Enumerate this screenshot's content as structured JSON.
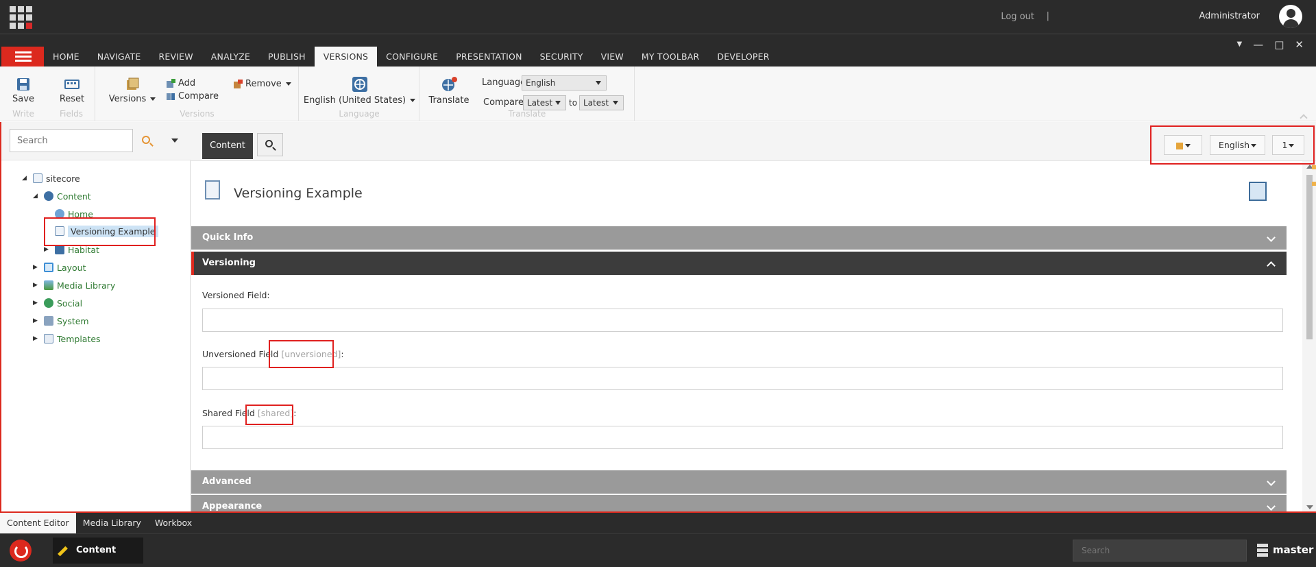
{
  "topbar": {
    "logout": "Log out",
    "separator": "|",
    "user": "Administrator"
  },
  "tabs": [
    "HOME",
    "NAVIGATE",
    "REVIEW",
    "ANALYZE",
    "PUBLISH",
    "VERSIONS",
    "CONFIGURE",
    "PRESENTATION",
    "SECURITY",
    "VIEW",
    "MY TOOLBAR",
    "DEVELOPER"
  ],
  "active_tab": "VERSIONS",
  "ribbon": {
    "write": {
      "save": "Save",
      "label": "Write"
    },
    "fields": {
      "reset": "Reset",
      "label": "Fields"
    },
    "versions": {
      "versions": "Versions",
      "add": "Add",
      "compare": "Compare",
      "remove": "Remove",
      "label": "Versions"
    },
    "language": {
      "current": "English (United States)",
      "label": "Language"
    },
    "translate": {
      "translate": "Translate",
      "language_label": "Language",
      "language_value": "English",
      "compare_label": "Compare",
      "compare_from": "Latest",
      "to_label": "to",
      "compare_to": "Latest",
      "label": "Translate"
    }
  },
  "left": {
    "search_placeholder": "Search",
    "tree": {
      "sitecore": "sitecore",
      "content": "Content",
      "home": "Home",
      "versioning_example": "Versioning Example",
      "habitat": "Habitat",
      "layout": "Layout",
      "media_library": "Media Library",
      "social": "Social",
      "system": "System",
      "templates": "Templates"
    }
  },
  "content": {
    "tab": "Content",
    "language": "English",
    "version": "1",
    "item_title": "Versioning Example",
    "sections": {
      "quick_info": "Quick Info",
      "versioning": "Versioning",
      "advanced": "Advanced",
      "appearance": "Appearance"
    },
    "fields": {
      "versioned_label": "Versioned Field:",
      "unversioned_label": "Unversioned Field",
      "unversioned_tag": "[unversioned]",
      "shared_label": "Shared Field",
      "shared_tag": "[shared]",
      "colon": ":"
    }
  },
  "bottom_tabs": [
    "Content Editor",
    "Media Library",
    "Workbox"
  ],
  "taskbar": {
    "app": "Content Editor",
    "search_placeholder": "Search",
    "database": "master"
  },
  "colors": {
    "brand_red": "#dc291e",
    "dark_bar": "#2b2b2b",
    "tree_green": "#2f7a32",
    "highlight_box": "#e0201f"
  }
}
